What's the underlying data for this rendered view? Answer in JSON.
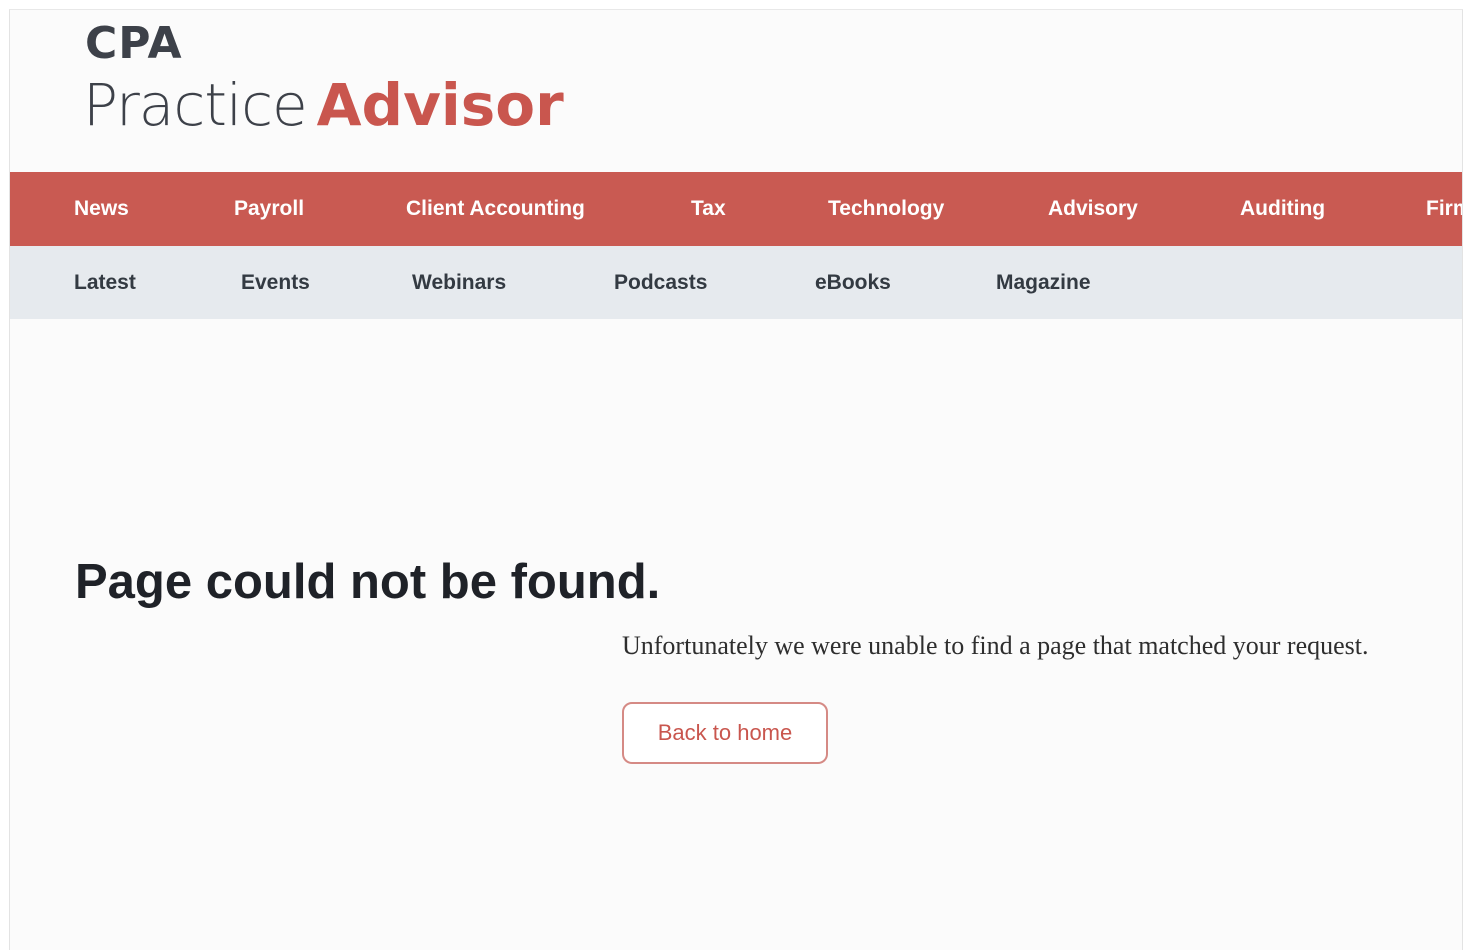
{
  "logo": {
    "line1": "CPA",
    "practice": "Practice",
    "advisor": "Advisor"
  },
  "primary_nav": {
    "items": [
      {
        "label": "News"
      },
      {
        "label": "Payroll"
      },
      {
        "label": "Client Accounting"
      },
      {
        "label": "Tax"
      },
      {
        "label": "Technology"
      },
      {
        "label": "Advisory"
      },
      {
        "label": "Auditing"
      },
      {
        "label": "Firm"
      }
    ]
  },
  "secondary_nav": {
    "items": [
      {
        "label": "Latest"
      },
      {
        "label": "Events"
      },
      {
        "label": "Webinars"
      },
      {
        "label": "Podcasts"
      },
      {
        "label": "eBooks"
      },
      {
        "label": "Magazine"
      }
    ]
  },
  "error": {
    "title": "Page could not be found.",
    "message": "Unfortunately we were unable to find a page that matched your request.",
    "button_label": "Back to home"
  },
  "colors": {
    "brand_red": "#c95a52",
    "logo_dark": "#3d4149",
    "secondary_bg": "#e6eaee"
  }
}
